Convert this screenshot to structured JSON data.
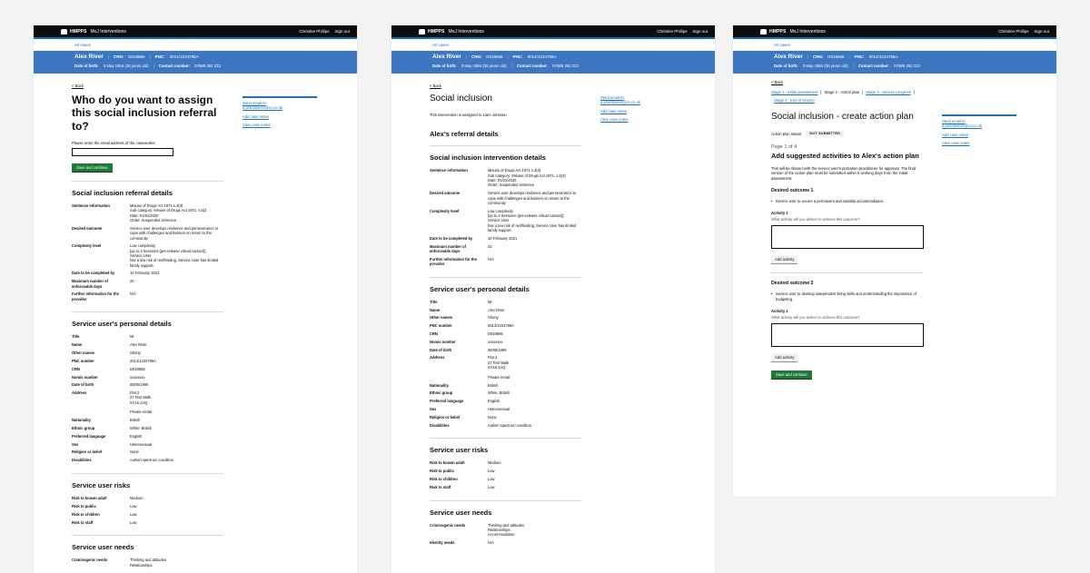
{
  "header": {
    "brand": "HMPPS",
    "service": "MoJ Interventions",
    "user": "Christine Phillips",
    "signout": "Sign out",
    "all_cases": "All cases"
  },
  "banner": {
    "name": "Alex River",
    "crn_label": "CRN:",
    "crn": "D018866",
    "pnc_label": "PNC:",
    "pnc": "2014/1234786A",
    "dob_label": "Date of birth:",
    "dob": "3 May 1984 (36 years old)",
    "contact_label": "Contact number:",
    "contact": "07589 362 222"
  },
  "sidebar": {
    "send_email": "Send email to",
    "email": "a.practitioner@co.co.uk",
    "add_notes": "Add case notes",
    "view_notes": "View case notes"
  },
  "back": "< Back",
  "screen1": {
    "title": "Who do you want to assign this social inclusion referral to?",
    "label": "Please enter the email address of the caseworker",
    "button": "Save and continue",
    "details_title": "Social inclusion referral details",
    "details": [
      {
        "k": "Sentence information",
        "v": "Misuse of Drugs Act 1971 s.4(3)\nSub category: Misuse of Drugs Act 1971, s.5(3\nDate: 01/01/2020\nOrder: Suspended sentence"
      },
      {
        "k": "Desired outcome",
        "v": "Service user develops resilience and perseverance to cope with challenges and barriers on return to the community"
      },
      {
        "k": "Complexity level",
        "v": "Low complexity\n[up to 4 Sessions (pre-release virtual contact)]\nService User\nhas a low risk of reoffending. Service User has limited family support."
      },
      {
        "k": "Date to be completed by",
        "v": "10 February 2021"
      },
      {
        "k": "Maximum number of enforceable days",
        "v": "20"
      },
      {
        "k": "Further information for the provider",
        "v": "N/A"
      }
    ],
    "personal_title": "Service user's personal details",
    "personal": [
      {
        "k": "Title",
        "v": "Mr"
      },
      {
        "k": "Name",
        "v": "Alex River"
      },
      {
        "k": "Other names",
        "v": "Shorty"
      },
      {
        "k": "PNC number",
        "v": "2014/1234786A"
      },
      {
        "k": "CRN",
        "v": "D018866"
      },
      {
        "k": "Nomis number",
        "v": "xxxxxxxx"
      },
      {
        "k": "Date of birth",
        "v": "08/05/1986"
      },
      {
        "k": "Address",
        "v": "Flat 2\n27 Test Walk\nSY16 1AQ\n\nPrivate rental"
      },
      {
        "k": "Nationality",
        "v": "British"
      },
      {
        "k": "Ethnic group",
        "v": "White: British"
      },
      {
        "k": "Preferred language",
        "v": "English"
      },
      {
        "k": "Sex",
        "v": "Heterosexual"
      },
      {
        "k": "Religion or belief",
        "v": "None"
      },
      {
        "k": "Disabilities",
        "v": "Autism spectrum condition"
      }
    ],
    "risks_title": "Service user risks",
    "risks": [
      {
        "k": "Risk to known adult",
        "v": "Medium"
      },
      {
        "k": "Risk to public",
        "v": "Low"
      },
      {
        "k": "Risk to children",
        "v": "Low"
      },
      {
        "k": "Risk to staff",
        "v": "Low"
      }
    ],
    "needs_title": "Service user needs",
    "needs": [
      {
        "k": "Criminogenic needs",
        "v": "Thinking and attitudes\nRelationships"
      }
    ]
  },
  "screen2": {
    "title": "Social inclusion",
    "assigned": "This intervention is assigned to Liam Johnson",
    "referral_title": "Alex's referral details",
    "details_title": "Social inclusion intervention details",
    "details": [
      {
        "k": "Sentence information",
        "v": "Misuse of Drugs Act 1971 s.4(3)\nSub category: Misuse of Drugs Act 1971, s.5(3)\nDate: 01/01/2020\nOrder: Suspended sentence"
      },
      {
        "k": "Desired outcome",
        "v": "Service user develops resilience and perseverance to cope with challenges and barriers on return to the community"
      },
      {
        "k": "Complexity level",
        "v": "Low complexity\n[up to 4 Sessions (pre-release virtual contact)]\nService User\nhas a low risk of reoffending, Service User has limited family support."
      },
      {
        "k": "Date to be completed by",
        "v": "10 February 2021"
      },
      {
        "k": "Maximum number of enforceable days",
        "v": "22"
      },
      {
        "k": "Further information for the provider",
        "v": "N/A"
      }
    ],
    "personal_title": "Service user's personal details",
    "personal": [
      {
        "k": "Title",
        "v": "Mr"
      },
      {
        "k": "Name",
        "v": "Alex River"
      },
      {
        "k": "Other names",
        "v": "Shorty"
      },
      {
        "k": "PNC number",
        "v": "2014/1234786A"
      },
      {
        "k": "CRN",
        "v": "D018866"
      },
      {
        "k": "Nomis number",
        "v": "xxxxxxxx"
      },
      {
        "k": "Date of birth",
        "v": "08/05/1986"
      },
      {
        "k": "Address",
        "v": "Flat 2\n27 Test Walk\nSY16 1AQ\n\nPrivate rental"
      },
      {
        "k": "Nationality",
        "v": "British"
      },
      {
        "k": "Ethnic group",
        "v": "White: British"
      },
      {
        "k": "Preferred language",
        "v": "English"
      },
      {
        "k": "Sex",
        "v": "Heterosexual"
      },
      {
        "k": "Religion or belief",
        "v": "None"
      },
      {
        "k": "Disabilities",
        "v": "Autism spectrum condition"
      }
    ],
    "risks_title": "Service user risks",
    "risks": [
      {
        "k": "Risk to known adult",
        "v": "Medium"
      },
      {
        "k": "Risk to public",
        "v": "Low"
      },
      {
        "k": "Risk to children",
        "v": "Low"
      },
      {
        "k": "Risk to staff",
        "v": "Low"
      }
    ],
    "needs_title": "Service user needs",
    "needs": [
      {
        "k": "Criminogenic needs",
        "v": "Thinking and attitudes\nRelationships\nAccommodation"
      },
      {
        "k": "Identity needs",
        "v": "N/A"
      }
    ]
  },
  "screen3": {
    "tabs": [
      "Stage 1 - Initial assessment",
      "Stage 2 - Action plan",
      "Stage 3 - Service progress",
      "Stage 4 - End of service"
    ],
    "title": "Social inclusion - create action plan",
    "status_label": "Action plan status:",
    "status": "NOT SUBMITTED",
    "page": "Page 1 of 4",
    "subtitle": "Add suggested activities to Alex's action plan",
    "intro": "This will be shared with the service user's probation practitioner for approval. The final version of the action plan must be submitted within 5 working days from the initial assessment.",
    "outcome1": "Desired outcome 1",
    "outcome1_text": "Service user to secure a permanent and suitable accommodation.",
    "activity1": "Activity 1",
    "hint": "What activity will you deliver to achieve this outcome?",
    "add": "Add activity",
    "outcome2": "Desired outcome 2",
    "outcome2_text": "Service user to develop independent living skills and understanding the importance of budgeting.",
    "activity2": "Activity 1",
    "save": "Save and continue"
  }
}
